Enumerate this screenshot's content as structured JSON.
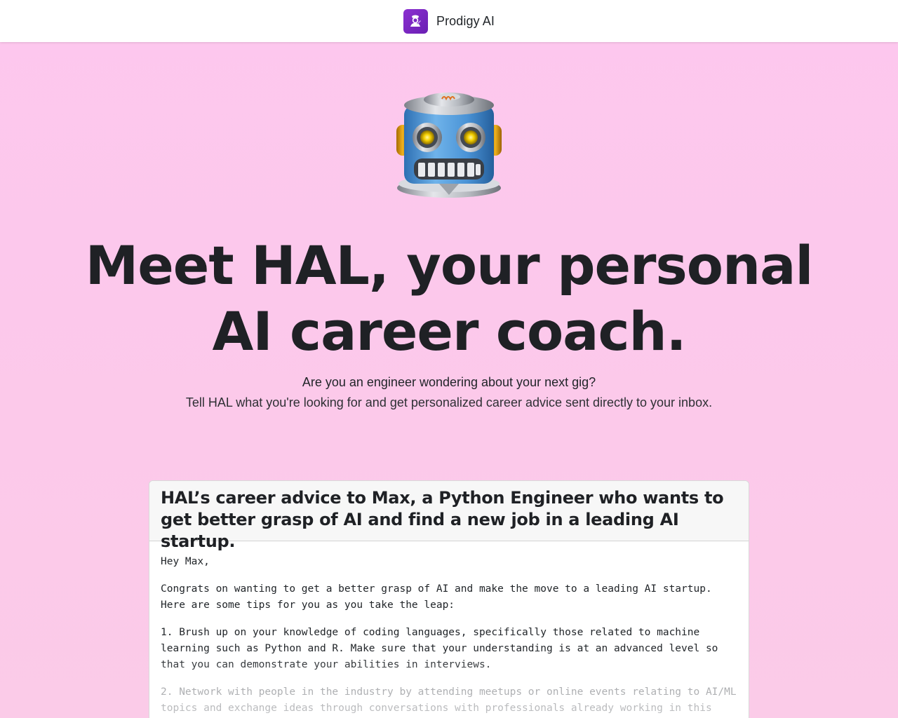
{
  "navbar": {
    "brand_name": "Prodigy AI",
    "logo_icon": "prodigy-logo-icon",
    "logo_color": "#7b27c4"
  },
  "hero": {
    "robot_icon": "robot-emoji-icon",
    "headline_line1": "Meet HAL, your personal",
    "headline_line2": "AI career coach.",
    "subtitle": "Are you an engineer wondering about your next gig?",
    "description": "Tell HAL what you're looking for and get personalized career advice sent directly to your inbox."
  },
  "example_card": {
    "title": "HAL’s career advice to Max, a Python Engineer who wants to get better grasp of AI and find a new job in a leading AI startup.",
    "paragraphs": [
      "Hey Max,",
      "Congrats on wanting to get a better grasp of AI and make the move to a leading AI startup. Here are some tips for you as you take the leap:",
      "1. Brush up on your knowledge of coding languages, specifically those related to machine learning such as Python and R. Make sure that your understanding is at an advanced level so that you can demonstrate your abilities in interviews.",
      "2. Network with people in the industry by attending meetups or online events relating to AI/ML topics and exchange ideas through conversations with professionals already working in this"
    ]
  },
  "colors": {
    "background": "#fdc7ee",
    "text": "#212529",
    "card_header_bg": "#f7f7f7"
  }
}
